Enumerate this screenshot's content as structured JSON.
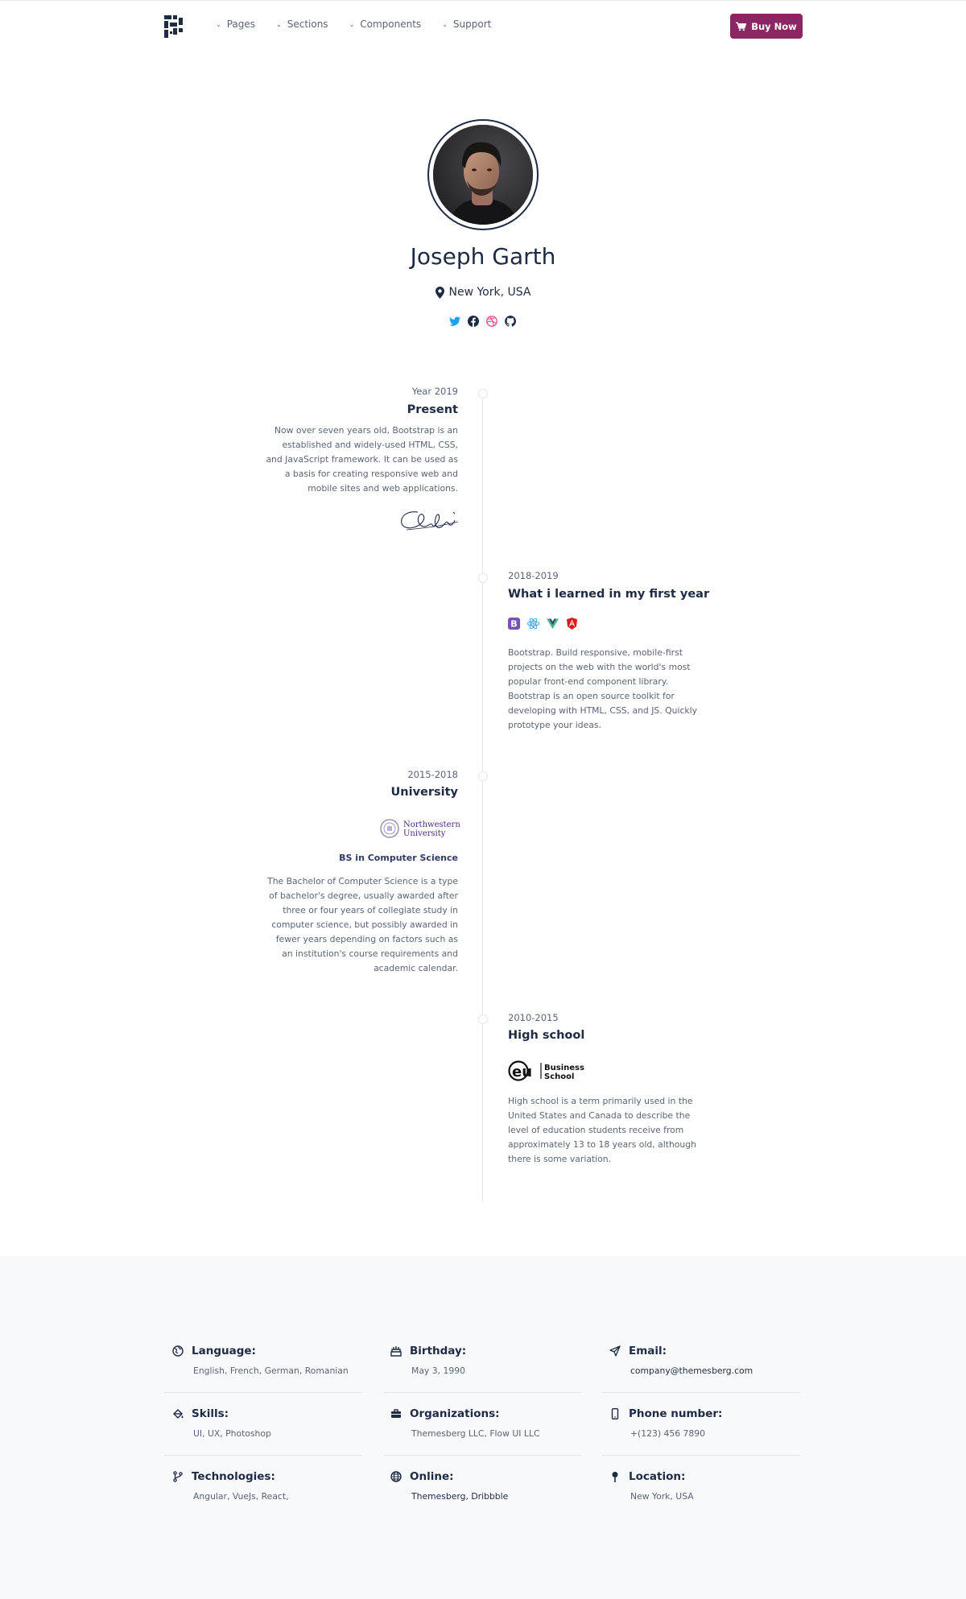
{
  "nav": {
    "items": [
      "Pages",
      "Sections",
      "Components",
      "Support"
    ],
    "buy_label": "Buy Now",
    "accent": "#8a2763"
  },
  "profile": {
    "name": "Joseph Garth",
    "location": "New York, USA",
    "socials": [
      "twitter-icon",
      "facebook-icon",
      "dribbble-icon",
      "github-icon"
    ]
  },
  "timeline": [
    {
      "date": "Year 2019",
      "title": "Present",
      "text": "Now over seven years old, Bootstrap is an established and widely-used HTML, CSS, and JavaScript framework. It can be used as a basis for creating responsive web and mobile sites and web applications."
    },
    {
      "date": "2018-2019",
      "title": "What i learned in my first year",
      "text": "Bootstrap. Build responsive, mobile-first projects on the web with the world's most popular front-end component library. Bootstrap is an open source toolkit for developing with HTML, CSS, and JS. Quickly prototype your ideas.",
      "tech_icons": [
        "bootstrap-icon",
        "react-icon",
        "vue-icon",
        "angular-icon"
      ]
    },
    {
      "date": "2015-2018",
      "title": "University",
      "logo_text": "Northwestern University",
      "degree": "BS in Computer Science",
      "text": "The Bachelor of Computer Science is a type of bachelor's degree, usually awarded after three or four years of collegiate study in computer science, but possibly awarded in fewer years depending on factors such as an institution's course requirements and academic calendar."
    },
    {
      "date": "2010-2015",
      "title": "High school",
      "logo_text": "eu Business School",
      "text": "High school is a term primarily used in the United States and Canada to describe the level of education students receive from approximately 13 to 18 years old, although there is some variation."
    }
  ],
  "info": [
    {
      "label": "Language:",
      "value": "English, French, German, Romanian",
      "icon": "language-icon"
    },
    {
      "label": "Birthday:",
      "value": "May 3, 1990",
      "icon": "cake-icon"
    },
    {
      "label": "Email:",
      "value": "company@themesberg.com",
      "icon": "paper-plane-icon"
    },
    {
      "label": "Skills:",
      "value": "UI, UX, Photoshop",
      "icon": "paint-bucket-icon"
    },
    {
      "label": "Organizations:",
      "value": "Themesberg LLC, Flow UI LLC",
      "icon": "briefcase-icon"
    },
    {
      "label": "Phone number:",
      "value": "+(123) 456 7890",
      "icon": "phone-icon"
    },
    {
      "label": "Technologies:",
      "value": "Angular, VueJs, React,",
      "icon": "code-branch-icon"
    },
    {
      "label": "Online:",
      "value": "Themesberg, Dribbble",
      "icon": "globe-icon"
    },
    {
      "label": "Location:",
      "value": "New York, USA",
      "icon": "map-pin-icon"
    }
  ]
}
